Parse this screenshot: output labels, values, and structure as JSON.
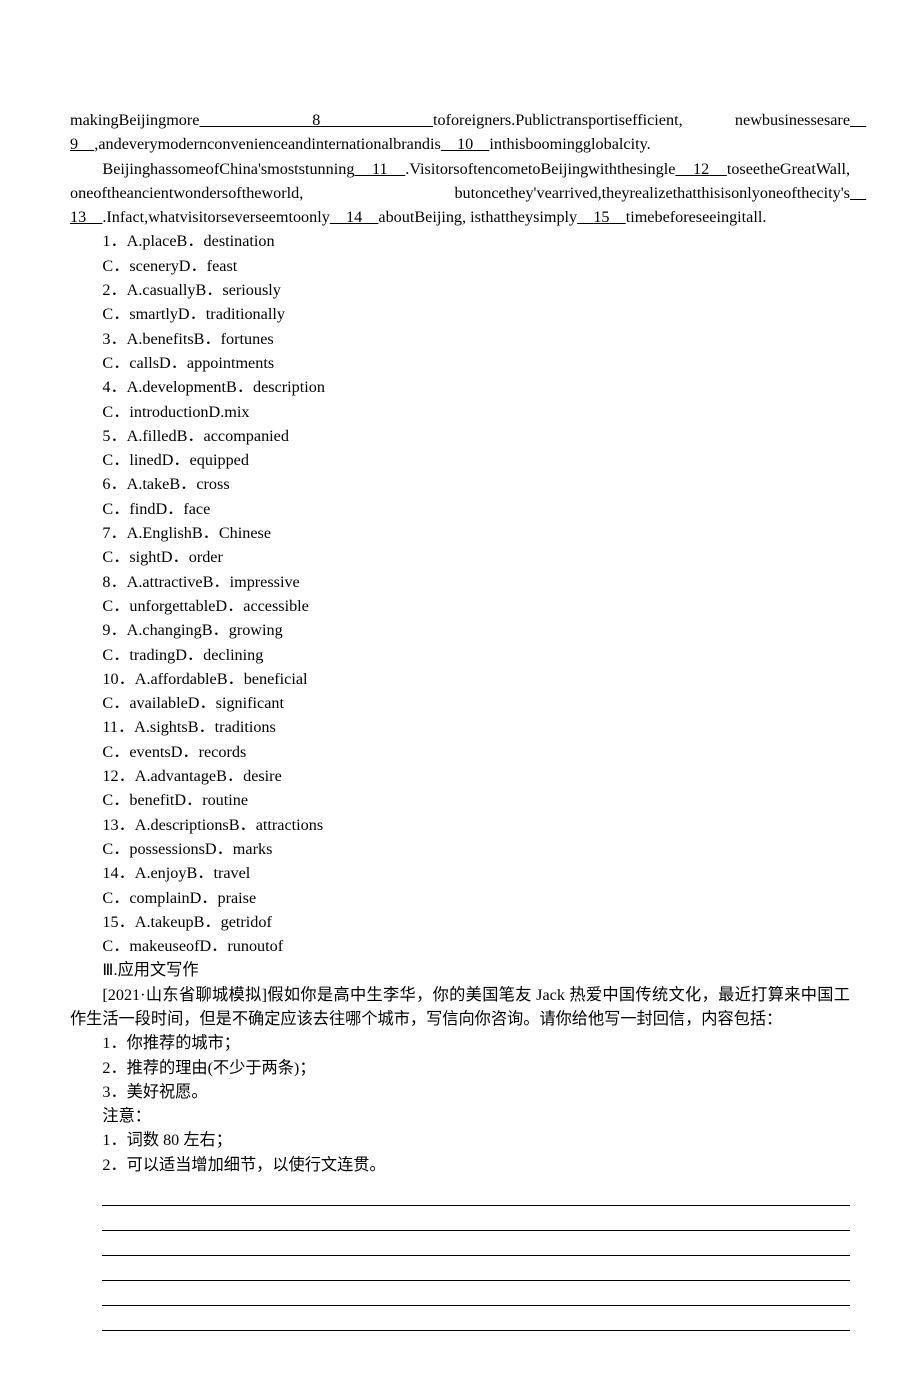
{
  "passage": {
    "para1_pre": "makingBeijingmore",
    "para1_b8": "8",
    "para1_after8": "toforeigners.Publictransportisefficient, newbusinessesare",
    "para1_b9": "9",
    "para1_after9": ",andeverymodernconvenienceandinternationalbrandis",
    "para1_b10": "10",
    "para1_after10": "inthisboomingglobalcity.",
    "para2_pre": "BeijinghassomeofChina'smoststunning",
    "para2_b11": "11",
    "para2_after11": ".VisitorsoftencometoBeijingwiththesingle",
    "para2_b12": "12",
    "para2_after12": "toseetheGreatWall, oneoftheancientwondersoftheworld, butoncethey'vearrived,theyrealizethatthisisonlyoneofthecity's",
    "para2_b13": "13",
    "para2_after13": ".Infact,whatvisitorseverseemtoonly",
    "para2_b14": "14",
    "para2_after14": "aboutBeijing, isthattheysimply",
    "para2_b15": "15",
    "para2_after15": "timebeforeseeingitall."
  },
  "questions": [
    {
      "num": "1",
      "line1": "A.placeB．destination",
      "line2": "C．sceneryD．feast"
    },
    {
      "num": "2",
      "line1": "A.casuallyB．seriously",
      "line2": "C．smartlyD．traditionally"
    },
    {
      "num": "3",
      "line1": "A.benefitsB．fortunes",
      "line2": "C．callsD．appointments"
    },
    {
      "num": "4",
      "line1": "A.developmentB．description",
      "line2": "C．introductionD.mix"
    },
    {
      "num": "5",
      "line1": "A.filledB．accompanied",
      "line2": "C．linedD．equipped"
    },
    {
      "num": "6",
      "line1": "A.takeB．cross",
      "line2": "C．findD．face"
    },
    {
      "num": "7",
      "line1": "A.EnglishB．Chinese",
      "line2": "C．sightD．order"
    },
    {
      "num": "8",
      "line1": "A.attractiveB．impressive",
      "line2": "C．unforgettableD．accessible"
    },
    {
      "num": "9",
      "line1": "A.changingB．growing",
      "line2": "C．tradingD．declining"
    },
    {
      "num": "10",
      "line1": "A.affordableB．beneficial",
      "line2": "C．availableD．significant"
    },
    {
      "num": "11",
      "line1": "A.sightsB．traditions",
      "line2": "C．eventsD．records"
    },
    {
      "num": "12",
      "line1": "A.advantageB．desire",
      "line2": "C．benefitD．routine"
    },
    {
      "num": "13",
      "line1": "A.descriptionsB．attractions",
      "line2": "C．possessionsD．marks"
    },
    {
      "num": "14",
      "line1": "A.enjoyB．travel",
      "line2": "C．complainD．praise"
    },
    {
      "num": "15",
      "line1": "A.takeupB．getridof",
      "line2": "C．makeuseofD．runoutof"
    }
  ],
  "writing": {
    "heading": "Ⅲ.应用文写作",
    "prompt": "[2021·山东省聊城模拟]假如你是高中生李华，你的美国笔友 Jack 热爱中国传统文化，最近打算来中国工作生活一段时间，但是不确定应该去往哪个城市，写信向你咨询。请你给他写一封回信，内容包括：",
    "pt1": "1．你推荐的城市；",
    "pt2": "2．推荐的理由(不少于两条)；",
    "pt3": "3．美好祝愿。",
    "note_label": "注意：",
    "note1": "1．词数 80 左右；",
    "note2": "2．可以适当增加细节，以使行文连贯。"
  }
}
